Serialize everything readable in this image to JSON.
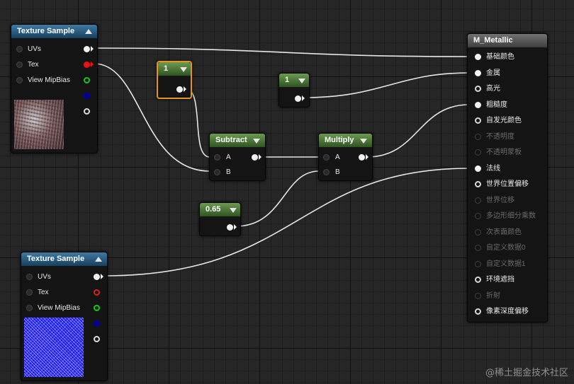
{
  "nodes": {
    "texture_sample_1": {
      "title": "Texture Sample",
      "pins": [
        "UVs",
        "Tex",
        "View MipBias"
      ]
    },
    "texture_sample_2": {
      "title": "Texture Sample",
      "pins": [
        "UVs",
        "Tex",
        "View MipBias"
      ]
    },
    "constant_1a": {
      "value": "1"
    },
    "constant_1b": {
      "value": "1"
    },
    "constant_065": {
      "value": "0.65"
    },
    "subtract": {
      "title": "Subtract",
      "pins": [
        "A",
        "B"
      ]
    },
    "multiply": {
      "title": "Multiply",
      "pins": [
        "A",
        "B"
      ]
    },
    "material": {
      "title": "M_Metallic",
      "pins": [
        {
          "label": "基础颜色",
          "enabled": true
        },
        {
          "label": "金属",
          "enabled": true
        },
        {
          "label": "高光",
          "enabled": true
        },
        {
          "label": "粗糙度",
          "enabled": true
        },
        {
          "label": "自发光颜色",
          "enabled": true
        },
        {
          "label": "不透明度",
          "enabled": false
        },
        {
          "label": "不透明蒙板",
          "enabled": false
        },
        {
          "label": "法线",
          "enabled": true
        },
        {
          "label": "世界位置偏移",
          "enabled": true
        },
        {
          "label": "世界位移",
          "enabled": false
        },
        {
          "label": "多边形细分乘数",
          "enabled": false
        },
        {
          "label": "次表面颜色",
          "enabled": false
        },
        {
          "label": "自定义数据0",
          "enabled": false
        },
        {
          "label": "自定义数据1",
          "enabled": false
        },
        {
          "label": "环境遮挡",
          "enabled": true
        },
        {
          "label": "折射",
          "enabled": false
        },
        {
          "label": "像素深度偏移",
          "enabled": true
        }
      ]
    }
  },
  "watermark": "@稀土掘金技术社区",
  "colors": {
    "selection": "#e5951b",
    "wire": "#e8e8e8"
  }
}
